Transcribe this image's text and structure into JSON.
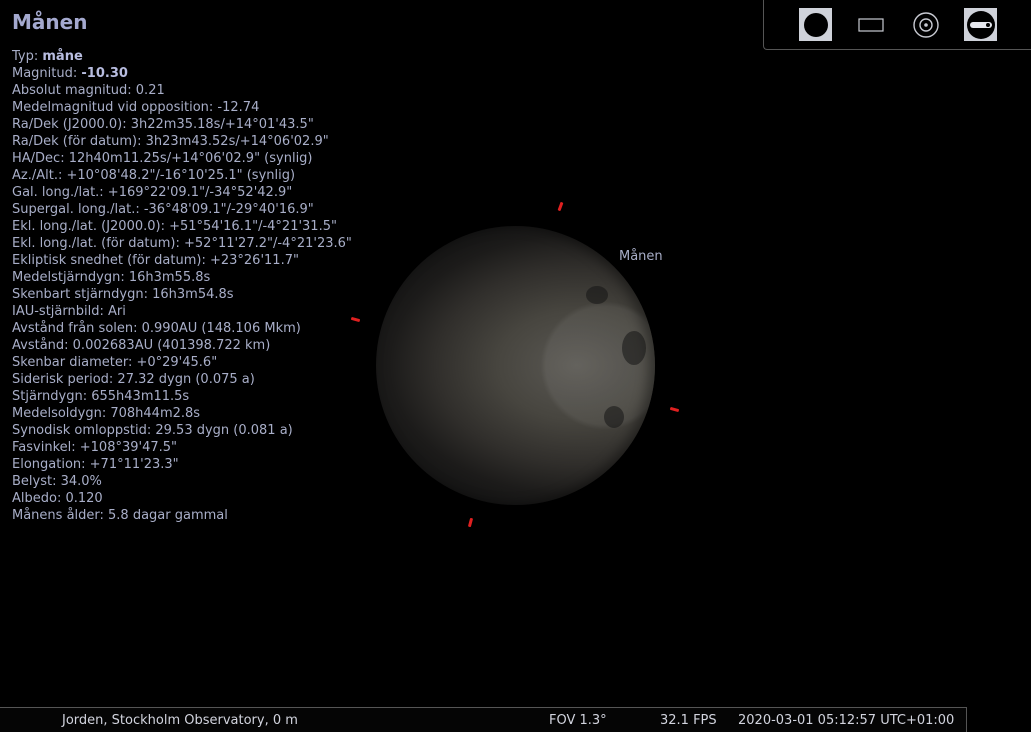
{
  "object": {
    "title": "Månen",
    "label_on_sky": "Månen"
  },
  "info": {
    "type_label": "Typ: ",
    "type_value": "måne",
    "mag_label": "Magnitud: ",
    "mag_value": "-10.30",
    "lines": [
      "Absolut magnitud: 0.21",
      "Medelmagnitud vid opposition: -12.74",
      "Ra/Dek (J2000.0): 3h22m35.18s/+14°01'43.5\"",
      "Ra/Dek (för datum): 3h23m43.52s/+14°06'02.9\"",
      "HA/Dec: 12h40m11.25s/+14°06'02.9\" (synlig)",
      "Az./Alt.: +10°08'48.2\"/-16°10'25.1\" (synlig)",
      "Gal. long./lat.: +169°22'09.1\"/-34°52'42.9\"",
      "Supergal. long./lat.: -36°48'09.1\"/-29°40'16.9\"",
      "Ekl. long./lat. (J2000.0): +51°54'16.1\"/-4°21'31.5\"",
      "Ekl. long./lat. (för datum): +52°11'27.2\"/-4°21'23.6\"",
      "Ekliptisk snedhet (för datum): +23°26'11.7\"",
      "Medelstjärndygn: 16h3m55.8s",
      "Skenbart stjärndygn: 16h3m54.8s",
      "IAU-stjärnbild: Ari",
      "Avstånd från solen: 0.990AU (148.106 Mkm)",
      "Avstånd: 0.002683AU (401398.722 km)",
      "Skenbar diameter: +0°29'45.6\"",
      "Siderisk period: 27.32 dygn (0.075 a)",
      "Stjärndygn: 655h43m11.5s",
      "Medelsoldygn: 708h44m2.8s",
      "Synodisk omloppstid: 29.53 dygn (0.081 a)",
      "Fasvinkel: +108°39'47.5\"",
      "Elongation: +71°11'23.3\"",
      "Belyst: 34.0%",
      "Albedo: 0.120",
      "Månens ålder: 5.8 dagar gammal"
    ]
  },
  "toolbar": {
    "buttons": [
      {
        "icon": "circle-icon",
        "active": false
      },
      {
        "icon": "rectangle-icon",
        "active": false
      },
      {
        "icon": "target-icon",
        "active": false
      },
      {
        "icon": "wrench-icon",
        "active": true
      }
    ]
  },
  "status": {
    "location": "Jorden, Stockholm Observatory, 0 m",
    "fov": "FOV 1.3°",
    "fps": "32.1 FPS",
    "datetime": "2020-03-01 05:12:57 UTC+01:00"
  },
  "colors": {
    "background": "#000000",
    "info_text": "#a8aec8",
    "title": "#a4a9cf",
    "marker": "#e02020"
  }
}
